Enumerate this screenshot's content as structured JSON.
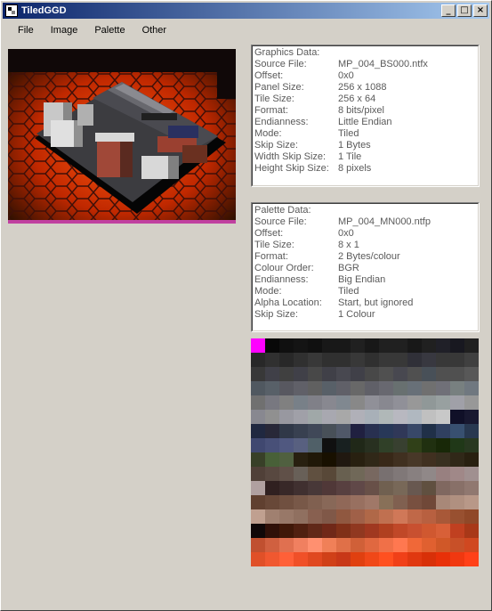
{
  "window": {
    "title": "TiledGGD"
  },
  "menu": [
    "File",
    "Image",
    "Palette",
    "Other"
  ],
  "graphics": {
    "heading": "Graphics Data:",
    "rows": [
      {
        "label": "Source File:",
        "value": "MP_004_BS000.ntfx"
      },
      {
        "label": "Offset:",
        "value": "0x0"
      },
      {
        "label": "Panel Size:",
        "value": "256 x 1088"
      },
      {
        "label": "Tile Size:",
        "value": "256 x 64"
      },
      {
        "label": "Format:",
        "value": "8 bits/pixel"
      },
      {
        "label": "Endianness:",
        "value": "Little Endian"
      },
      {
        "label": "Mode:",
        "value": "Tiled"
      },
      {
        "label": "Skip Size:",
        "value": "1 Bytes"
      },
      {
        "label": "Width Skip Size:",
        "value": "1 Tile"
      },
      {
        "label": "Height Skip Size:",
        "value": "8 pixels"
      }
    ]
  },
  "palette_info": {
    "heading": "Palette Data:",
    "rows": [
      {
        "label": "Source File:",
        "value": "MP_004_MN000.ntfp"
      },
      {
        "label": "Offset:",
        "value": "0x0"
      },
      {
        "label": "Tile Size:",
        "value": "8 x 1"
      },
      {
        "label": "Format:",
        "value": "2 Bytes/colour"
      },
      {
        "label": "Colour Order:",
        "value": "BGR"
      },
      {
        "label": "Endianness:",
        "value": "Big Endian"
      },
      {
        "label": "Mode:",
        "value": "Tiled"
      },
      {
        "label": "Alpha Location:",
        "value": "Start, but ignored"
      },
      {
        "label": "Skip Size:",
        "value": "1 Colour"
      }
    ]
  },
  "palette_rows": [
    [
      "#ff00ff",
      "#080808",
      "#101010",
      "#141414",
      "#101010",
      "#181818",
      "#181818",
      "#202020",
      "#181818",
      "#202020",
      "#202020",
      "#181818",
      "#202020",
      "#202028",
      "#181820",
      "#202020"
    ],
    [
      "#282828",
      "#303030",
      "#282828",
      "#303030",
      "#383838",
      "#303030",
      "#303030",
      "#383838",
      "#303030",
      "#383838",
      "#383838",
      "#303038",
      "#383840",
      "#383838",
      "#383838",
      "#404040"
    ],
    [
      "#383838",
      "#404048",
      "#404040",
      "#404048",
      "#484848",
      "#404048",
      "#484850",
      "#404048",
      "#484848",
      "#505050",
      "#484850",
      "#505050",
      "#485058",
      "#505050",
      "#505050",
      "#585858"
    ],
    [
      "#505860",
      "#586068",
      "#585860",
      "#606068",
      "#606060",
      "#586068",
      "#606068",
      "#686868",
      "#606068",
      "#686870",
      "#687070",
      "#687078",
      "#707070",
      "#707078",
      "#788080",
      "#707880"
    ],
    [
      "#707070",
      "#787880",
      "#808080",
      "#788088",
      "#808088",
      "#888890",
      "#808890",
      "#888888",
      "#909098",
      "#888890",
      "#909098",
      "#989898",
      "#909898",
      "#98a0a0",
      "#a0a0a8",
      "#989898"
    ],
    [
      "#888890",
      "#909090",
      "#9898a0",
      "#a0a0a8",
      "#a0a8a8",
      "#a8a8b0",
      "#a8a8a8",
      "#b0b0b8",
      "#a8b0b8",
      "#b0b8b8",
      "#b8b8c0",
      "#b0b8c0",
      "#c0c0c0",
      "#c8c8c8",
      "#101028",
      "#181830"
    ],
    [
      "#202840",
      "#282838",
      "#303848",
      "#384050",
      "#404858",
      "#485058",
      "#505868",
      "#202040",
      "#283050",
      "#283858",
      "#303858",
      "#384868",
      "#203048",
      "#304060",
      "#385070",
      "#283850"
    ],
    [
      "#404870",
      "#485078",
      "#505880",
      "#586080",
      "#506068",
      "#101010",
      "#182020",
      "#202818",
      "#283020",
      "#304028",
      "#384030",
      "#304018",
      "#203010",
      "#182808",
      "#203818",
      "#283820"
    ],
    [
      "#384028",
      "#486038",
      "#506040",
      "#282010",
      "#201808",
      "#181000",
      "#201810",
      "#282010",
      "#302818",
      "#382818",
      "#403020",
      "#483828",
      "#403020",
      "#383020",
      "#302818",
      "#282010"
    ],
    [
      "#504038",
      "#584840",
      "#605048",
      "#686058",
      "#605040",
      "#584838",
      "#686050",
      "#706858",
      "#786860",
      "#787070",
      "#807878",
      "#888080",
      "#908888",
      "#988080",
      "#a08888",
      "#a09090"
    ],
    [
      "#b0a0a0",
      "#302020",
      "#382828",
      "#403030",
      "#483838",
      "#503838",
      "#584040",
      "#604848",
      "#685048",
      "#706050",
      "#786858",
      "#685850",
      "#605040",
      "#806860",
      "#887068",
      "#907870"
    ],
    [
      "#604030",
      "#684838",
      "#705040",
      "#785848",
      "#806050",
      "#886858",
      "#906858",
      "#987060",
      "#a07868",
      "#887058",
      "#806050",
      "#785040",
      "#704838",
      "#a88878",
      "#b09080",
      "#b89888"
    ],
    [
      "#c0a090",
      "#a08070",
      "#987868",
      "#907060",
      "#886050",
      "#805848",
      "#905840",
      "#a06048",
      "#b06848",
      "#c07050",
      "#d07858",
      "#c06848",
      "#b86040",
      "#a85838",
      "#985030",
      "#904828"
    ],
    [
      "#100808",
      "#301008",
      "#401808",
      "#502010",
      "#602818",
      "#702818",
      "#803018",
      "#903820",
      "#a03820",
      "#b04020",
      "#c04828",
      "#c85030",
      "#d05830",
      "#d86038",
      "#c04020",
      "#a83818"
    ],
    [
      "#c05030",
      "#d06040",
      "#e07050",
      "#f08060",
      "#ff9070",
      "#f08058",
      "#e07048",
      "#d06038",
      "#e06840",
      "#f07048",
      "#ff7850",
      "#f06838",
      "#e06030",
      "#d05828",
      "#c85028",
      "#d04820"
    ],
    [
      "#e05028",
      "#f05830",
      "#ff6038",
      "#f05028",
      "#e04820",
      "#d04018",
      "#c83818",
      "#e04010",
      "#f04818",
      "#ff5020",
      "#f04018",
      "#e03810",
      "#d83008",
      "#e83008",
      "#f03810",
      "#ff4018"
    ]
  ]
}
